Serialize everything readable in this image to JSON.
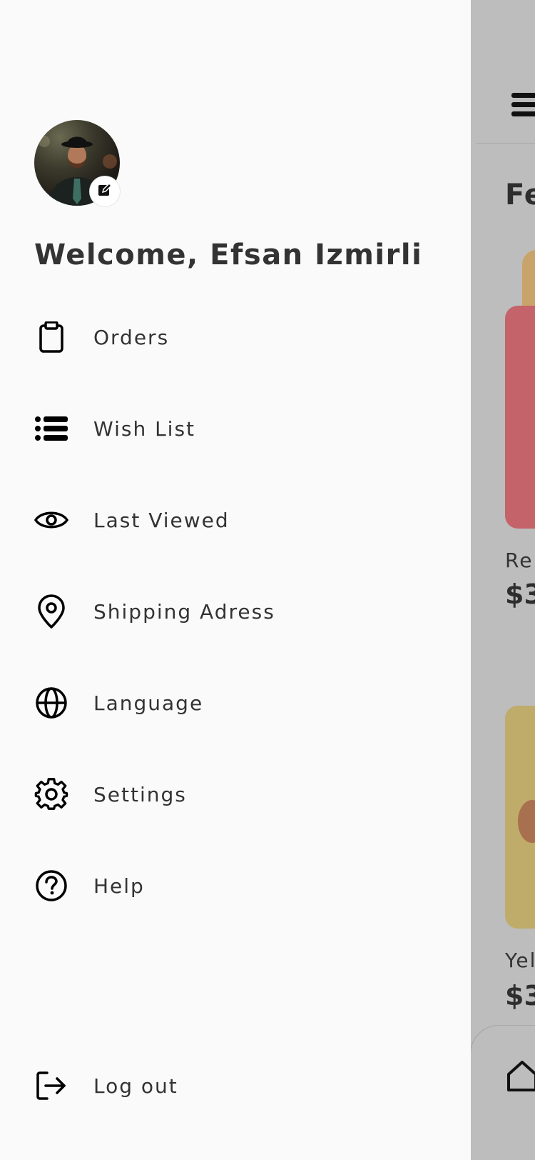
{
  "drawer": {
    "welcome_text": "Welcome, Efsan Izmirli",
    "menu": [
      {
        "label": "Orders",
        "icon": "clipboard-icon"
      },
      {
        "label": "Wish List",
        "icon": "list-icon"
      },
      {
        "label": "Last Viewed",
        "icon": "eye-icon"
      },
      {
        "label": "Shipping Adress",
        "icon": "map-pin-icon"
      },
      {
        "label": "Language",
        "icon": "globe-icon"
      },
      {
        "label": "Settings",
        "icon": "gear-icon"
      },
      {
        "label": "Help",
        "icon": "help-circle-icon"
      }
    ],
    "logout": {
      "label": "Log out",
      "icon": "logout-icon"
    }
  },
  "background_page": {
    "section_title": "Fe",
    "products": [
      {
        "name": "Re",
        "price": "$3"
      },
      {
        "name": "Yel",
        "price": "$3"
      }
    ]
  },
  "colors": {
    "drawer_bg": "#fafafa",
    "overlay": "#bdbdbd",
    "text": "#333333",
    "card_red": "#c4636a",
    "card_yellow": "#bfab6a"
  }
}
